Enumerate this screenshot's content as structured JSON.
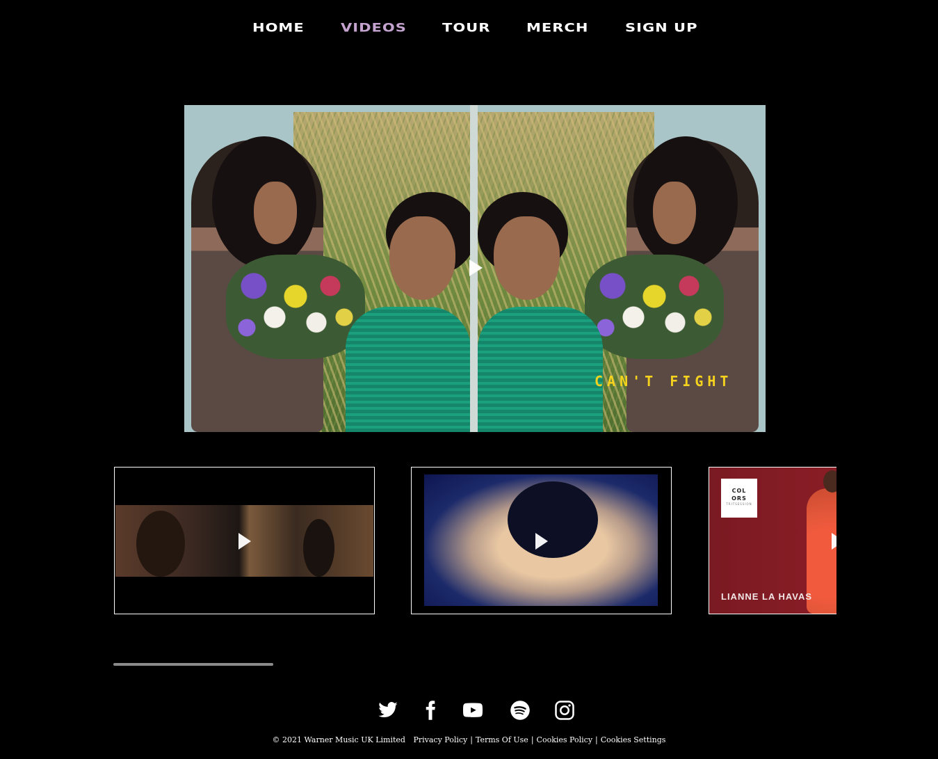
{
  "nav": {
    "items": [
      {
        "label": "HOME",
        "active": false
      },
      {
        "label": "VIDEOS",
        "active": true
      },
      {
        "label": "TOUR",
        "active": false
      },
      {
        "label": "MERCH",
        "active": false
      },
      {
        "label": "SIGN UP",
        "active": false
      }
    ],
    "active_color": "#c5a3cf"
  },
  "main_video": {
    "overlay_text": "CAN'T FIGHT",
    "icon": "play-icon"
  },
  "thumbnails": [
    {
      "icon": "play-icon"
    },
    {
      "icon": "play-icon"
    },
    {
      "icon": "play-icon",
      "badge_lines": [
        "COL",
        "ORS",
        "TRITSESSION"
      ],
      "caption": "LIANNE LA HAVAS"
    }
  ],
  "social": [
    "twitter-icon",
    "facebook-icon",
    "youtube-icon",
    "spotify-icon",
    "instagram-icon"
  ],
  "footer": {
    "copyright": "© 2021 Warner Music UK Limited",
    "links": [
      "Privacy Policy",
      "Terms Of Use",
      "Cookies Policy",
      "Cookies Settings"
    ],
    "separator": "|"
  }
}
